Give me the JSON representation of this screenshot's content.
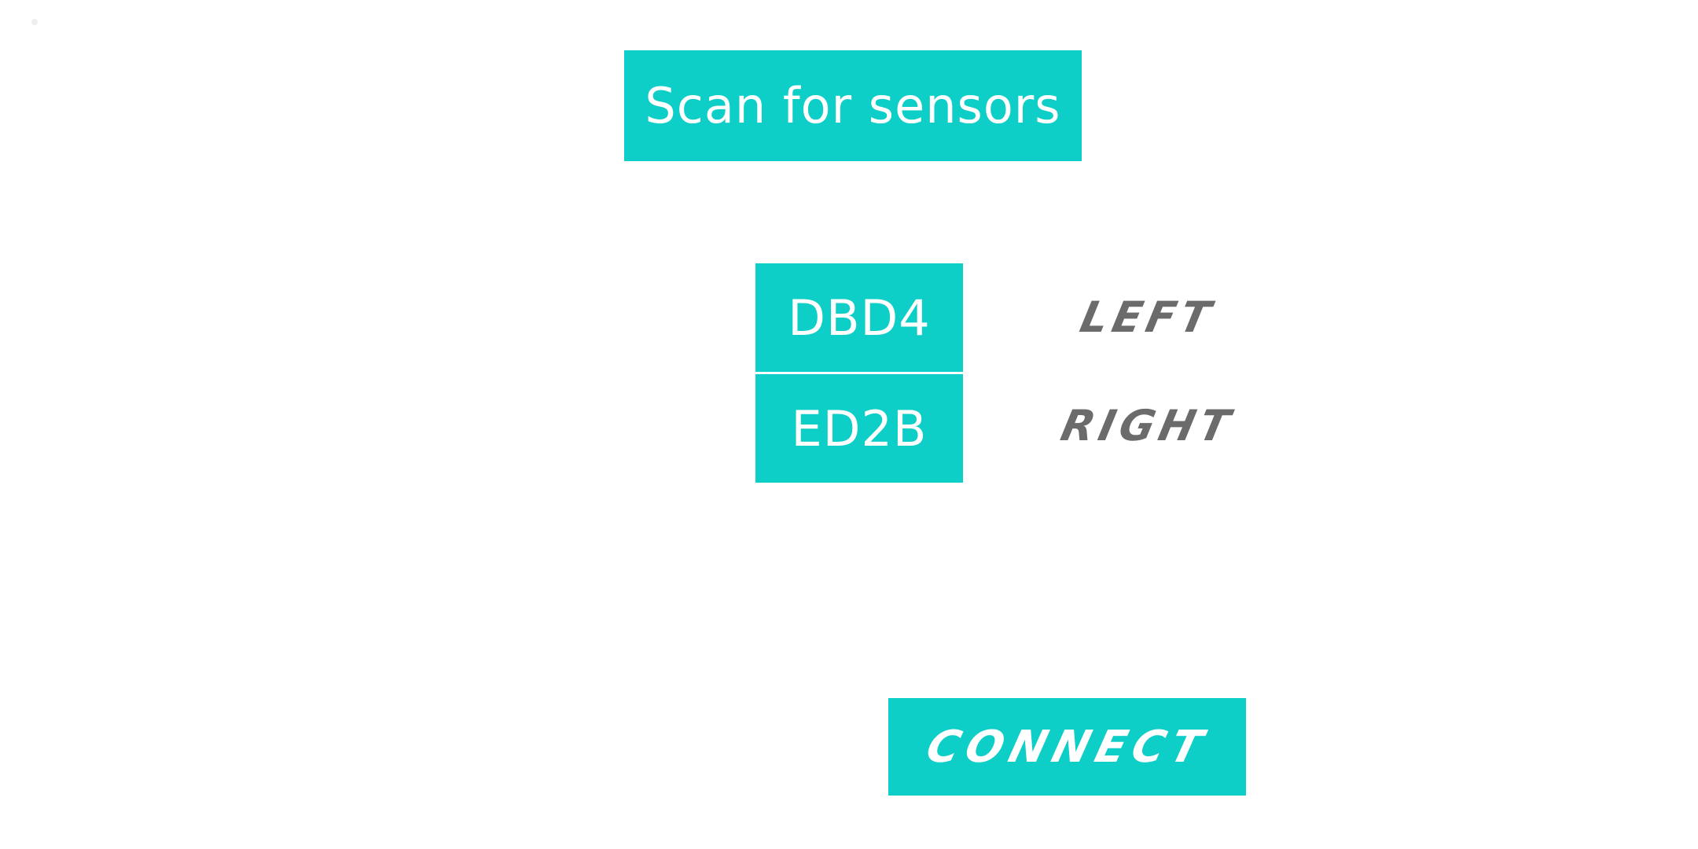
{
  "scan": {
    "label": "Scan for sensors"
  },
  "sensors": [
    {
      "id": "DBD4",
      "side": "LEFT"
    },
    {
      "id": "ED2B",
      "side": "RIGHT"
    }
  ],
  "connect": {
    "label": "CONNECT"
  },
  "colors": {
    "accent": "#0ecfc7",
    "label_gray": "#6b6b6b",
    "background": "#ffffff"
  }
}
